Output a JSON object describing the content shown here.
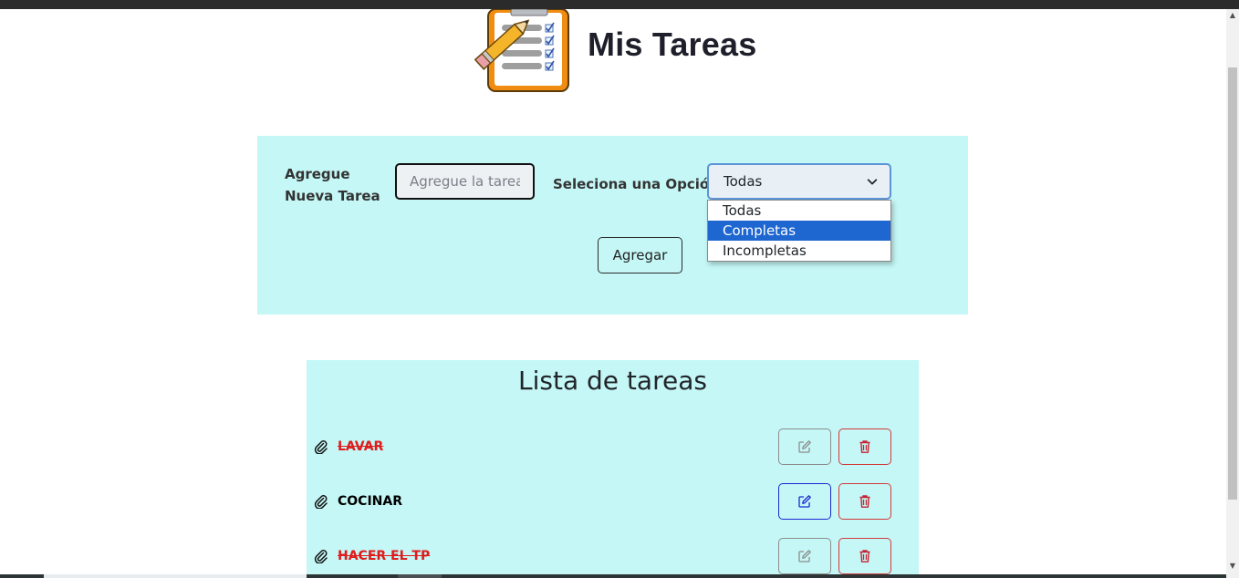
{
  "header": {
    "title": "Mis Tareas",
    "logo_icon": "clipboard-checklist-pencil-icon"
  },
  "form": {
    "task_label": "Agregue Nueva Tarea",
    "task_input_placeholder": "Agregue la tarea",
    "task_input_value": "",
    "select_label": "Seleciona una Opción",
    "select_value": "Todas",
    "add_button_label": "Agregar",
    "panel_color": "#c4f7f6"
  },
  "dropdown": {
    "open": true,
    "options": [
      {
        "label": "Todas",
        "highlighted": false
      },
      {
        "label": "Completas",
        "highlighted": true
      },
      {
        "label": "Incompletas",
        "highlighted": false
      }
    ],
    "highlight_color": "#1e66d0"
  },
  "task_list": {
    "title": "Lista de tareas",
    "tasks": [
      {
        "name": "LAVAR",
        "completed": true,
        "edit_icon": "edit-icon",
        "delete_icon": "trash-icon"
      },
      {
        "name": "COCINAR",
        "completed": false,
        "edit_icon": "edit-icon",
        "delete_icon": "trash-icon"
      },
      {
        "name": "HACER EL TP",
        "completed": true,
        "edit_icon": "edit-icon",
        "delete_icon": "trash-icon"
      }
    ],
    "completed_text_color": "#e01b1b",
    "edit_active_color": "#1b28d4",
    "delete_color": "#d33a3a"
  }
}
